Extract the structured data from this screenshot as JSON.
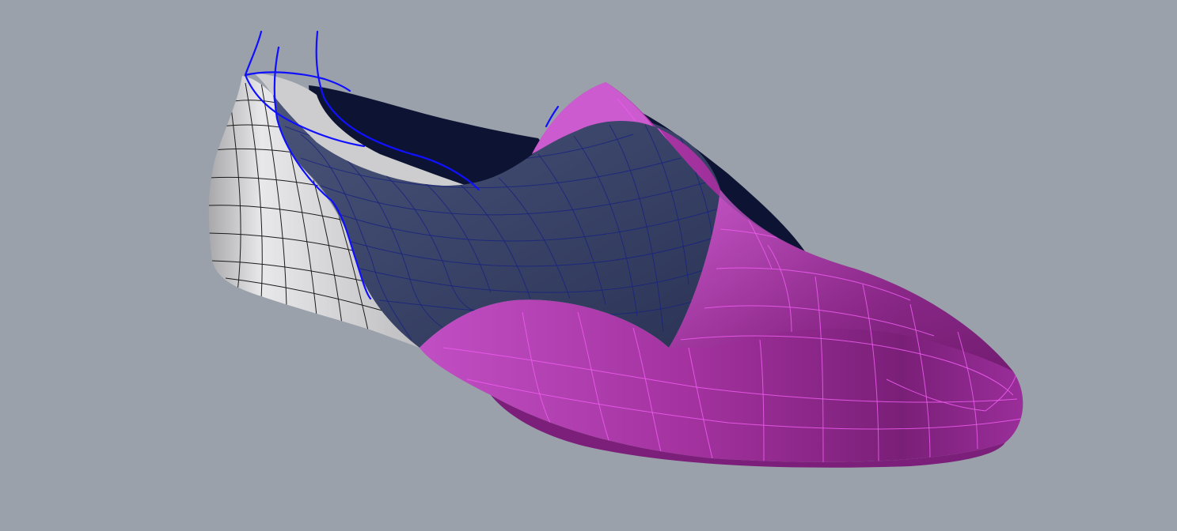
{
  "viewport": {
    "background": "#9aa1ab",
    "render_mode": "shaded"
  },
  "scene": {
    "object": "shoe-model",
    "parts": [
      {
        "name": "heel-counter",
        "color": "#d0d0d2",
        "wire_color": "#1b1b1b"
      },
      {
        "name": "quarter-panel",
        "color": "#3b4568",
        "wire_color": "#1a237e"
      },
      {
        "name": "inner-lining",
        "color": "#0d1433"
      },
      {
        "name": "vamp-toe",
        "color": "#b13bb3",
        "wire_color": "#ee5cf0"
      }
    ],
    "selection_color": "#1010ff"
  }
}
